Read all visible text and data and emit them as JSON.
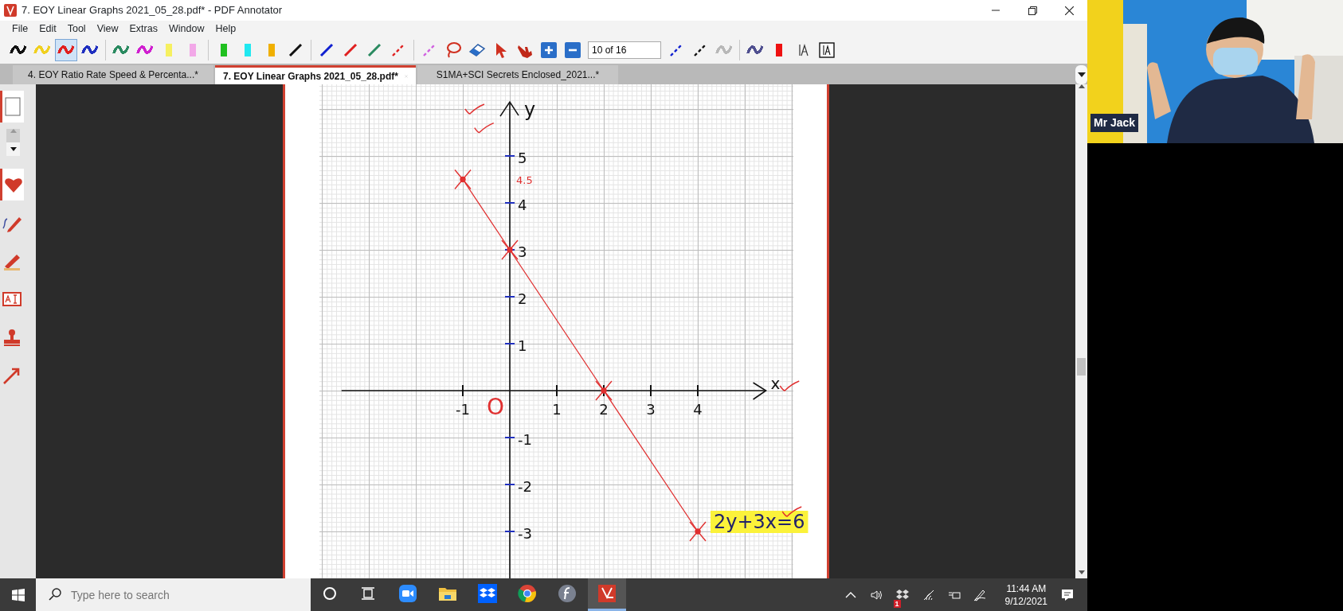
{
  "window": {
    "title": "7. EOY Linear Graphs 2021_05_28.pdf* - PDF Annotator"
  },
  "menu": [
    "File",
    "Edit",
    "Tool",
    "View",
    "Extras",
    "Window",
    "Help"
  ],
  "toolbar": [
    {
      "kind": "pen",
      "color": "#111111",
      "selected": false
    },
    {
      "kind": "pen",
      "color": "#f0d020",
      "selected": false
    },
    {
      "kind": "pen",
      "color": "#e02020",
      "selected": true
    },
    {
      "kind": "pen",
      "color": "#2030c0",
      "selected": false
    },
    {
      "kind": "separator"
    },
    {
      "kind": "pen",
      "color": "#2a8a60",
      "selected": false
    },
    {
      "kind": "pen",
      "color": "#d020d0",
      "selected": false
    },
    {
      "kind": "highlighter",
      "color": "#f6f060",
      "selected": false
    },
    {
      "kind": "highlighter",
      "color": "#f2a8e8",
      "selected": false
    },
    {
      "kind": "separator"
    },
    {
      "kind": "highlighter",
      "color": "#20c020",
      "selected": false
    },
    {
      "kind": "highlighter",
      "color": "#20e8f0",
      "selected": false
    },
    {
      "kind": "highlighter",
      "color": "#f0b000",
      "selected": false
    },
    {
      "kind": "line",
      "color": "#111111",
      "selected": false
    },
    {
      "kind": "separator"
    },
    {
      "kind": "line",
      "color": "#1020d0",
      "selected": false
    },
    {
      "kind": "line",
      "color": "#e02020",
      "selected": false
    },
    {
      "kind": "line",
      "color": "#2a8a60",
      "selected": false
    },
    {
      "kind": "dashed",
      "color": "#e02020",
      "selected": false
    },
    {
      "kind": "separator"
    },
    {
      "kind": "dashed",
      "color": "#d060e0",
      "selected": false
    },
    {
      "kind": "lasso",
      "selected": false
    },
    {
      "kind": "eraser",
      "selected": false
    },
    {
      "kind": "pointer",
      "selected": false
    },
    {
      "kind": "hand",
      "selected": false
    },
    {
      "kind": "zoom-in",
      "selected": false
    },
    {
      "kind": "zoom-out",
      "selected": false
    },
    {
      "kind": "page-field",
      "value": "10 of 16"
    },
    {
      "kind": "dashed",
      "color": "#1020d0",
      "selected": false
    },
    {
      "kind": "dashed",
      "color": "#111111",
      "selected": false
    },
    {
      "kind": "pen",
      "color": "#b8b8b8",
      "selected": false
    },
    {
      "kind": "separator"
    },
    {
      "kind": "pen",
      "color": "#505090",
      "selected": false
    },
    {
      "kind": "highlighter",
      "color": "#ee1111",
      "selected": false
    },
    {
      "kind": "text-tool",
      "selected": false
    },
    {
      "kind": "text-box",
      "selected": false
    }
  ],
  "tabs": [
    {
      "label": "4. EOY Ratio Rate Speed & Percenta...*",
      "selected": false
    },
    {
      "label": "7. EOY Linear Graphs 2021_05_28.pdf*",
      "selected": true
    },
    {
      "label": "S1MA+SCI Secrets Enclosed_2021...*",
      "selected": false
    }
  ],
  "sidebar": {
    "items": [
      {
        "kind": "page",
        "selected": true
      },
      {
        "kind": "scroller"
      },
      {
        "kind": "heart",
        "selected": true
      },
      {
        "kind": "pen",
        "selected": false
      },
      {
        "kind": "highlighter",
        "selected": false
      },
      {
        "kind": "text-field",
        "selected": false
      },
      {
        "kind": "stamp",
        "selected": false
      },
      {
        "kind": "arrow",
        "selected": false
      }
    ]
  },
  "document": {
    "chart_data": {
      "type": "line",
      "xlabel": "x",
      "ylabel": "y",
      "x": [
        -1,
        0,
        2,
        4
      ],
      "series": [
        {
          "name": "2y+3x=6",
          "color": "#e03030",
          "marker": "x",
          "values": [
            4.5,
            3,
            0,
            -3
          ]
        }
      ],
      "xlim": [
        -3.58,
        5.45
      ],
      "ylim": [
        -4,
        6.15
      ],
      "xticks": [
        -1,
        1,
        2,
        3,
        4
      ],
      "yticks": [
        -3,
        -2,
        -1,
        1,
        2,
        3,
        4,
        5
      ],
      "annotations": [
        "4.5",
        "O"
      ]
    }
  },
  "video": {
    "participant": "Mr Jack"
  },
  "taskbar": {
    "search": {
      "placeholder": "Type here to search"
    },
    "apps": [
      {
        "kind": "zoom",
        "selected": false
      },
      {
        "kind": "folder",
        "selected": false
      },
      {
        "kind": "dropbox",
        "selected": false
      },
      {
        "kind": "chrome",
        "selected": false
      },
      {
        "kind": "flash",
        "selected": false
      },
      {
        "kind": "pdf-annotator",
        "selected": true
      }
    ],
    "tray": {
      "badge": "1",
      "time": "11:44 AM",
      "date": "9/12/2021"
    }
  }
}
